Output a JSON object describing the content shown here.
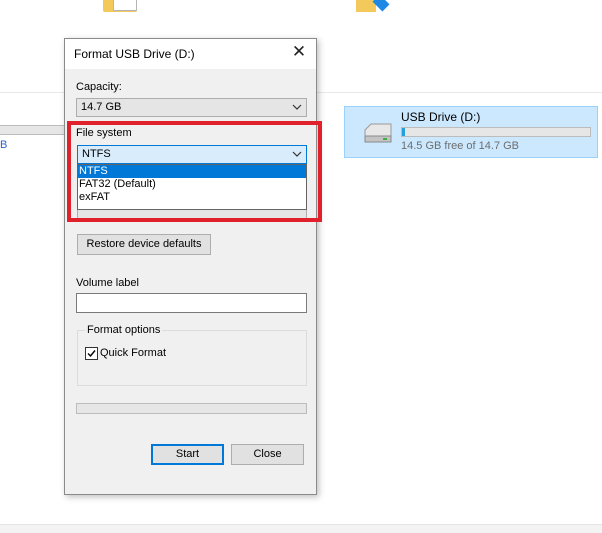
{
  "background": {
    "left_text": "B",
    "drive": {
      "name": "USB Drive (D:)",
      "free_text": "14.5 GB free of 14.7 GB",
      "used_fraction": 0.014
    }
  },
  "dialog": {
    "title": "Format USB Drive (D:)",
    "capacity": {
      "label": "Capacity:",
      "value": "14.7 GB"
    },
    "file_system": {
      "label": "File system",
      "selected": "NTFS",
      "options": [
        "NTFS",
        "FAT32 (Default)",
        "exFAT"
      ]
    },
    "restore_button": "Restore device defaults",
    "volume_label": {
      "label": "Volume label",
      "value": ""
    },
    "format_options": {
      "label": "Format options",
      "quick_format_label": "Quick Format",
      "quick_format_checked": true
    },
    "progress": 0,
    "start_button": "Start",
    "close_button": "Close"
  },
  "colors": {
    "highlight": "#e0202a",
    "accent": "#0078d7",
    "drive_selection": "#cce8ff"
  }
}
